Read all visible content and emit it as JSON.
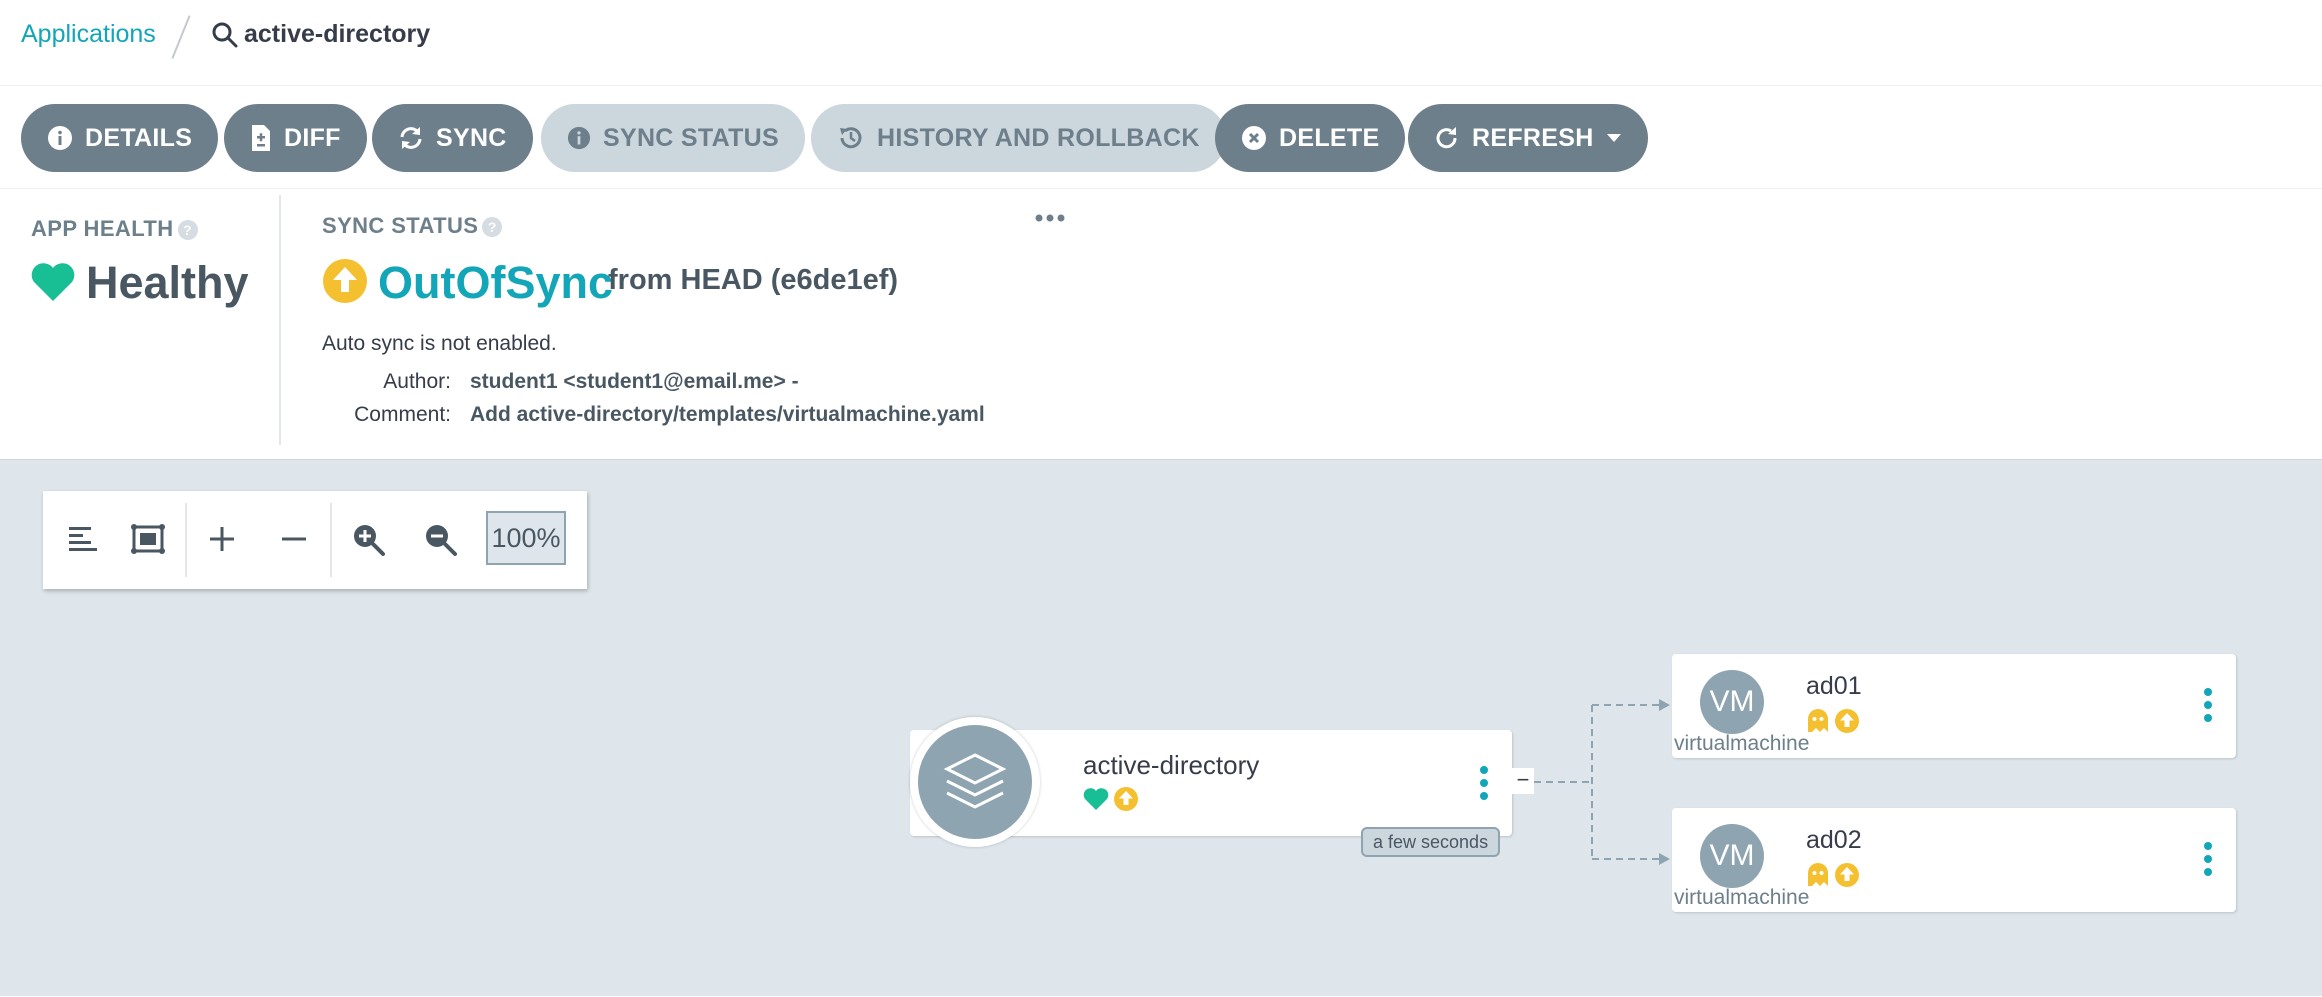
{
  "breadcrumb": {
    "root": "Applications",
    "current": "active-directory"
  },
  "toolbar": {
    "details": "DETAILS",
    "diff": "DIFF",
    "sync": "SYNC",
    "sync_status": "SYNC STATUS",
    "history": "HISTORY AND ROLLBACK",
    "delete": "DELETE",
    "refresh": "REFRESH"
  },
  "health": {
    "label": "APP HEALTH",
    "value": "Healthy",
    "color": "#18be94"
  },
  "sync": {
    "label": "SYNC STATUS",
    "value": "OutOfSync",
    "from": "from HEAD (e6de1ef)",
    "auto_sync": "Auto sync is not enabled.",
    "author_label": "Author:",
    "author": "student1 <student1@email.me> -",
    "comment_label": "Comment:",
    "comment": "Add active-directory/templates/virtualmachine.yaml",
    "color": "#f4c030"
  },
  "zoom": {
    "level": "100%"
  },
  "graph": {
    "app": {
      "name": "active-directory",
      "age": "a few seconds",
      "collapse": "−"
    },
    "resources": [
      {
        "icon_text": "VM",
        "name": "ad01",
        "kind": "virtualmachine"
      },
      {
        "icon_text": "VM",
        "name": "ad02",
        "kind": "virtualmachine"
      }
    ]
  },
  "colors": {
    "accent": "#13a5b8",
    "button": "#6d7f8b",
    "canvas": "#dee6eb"
  }
}
